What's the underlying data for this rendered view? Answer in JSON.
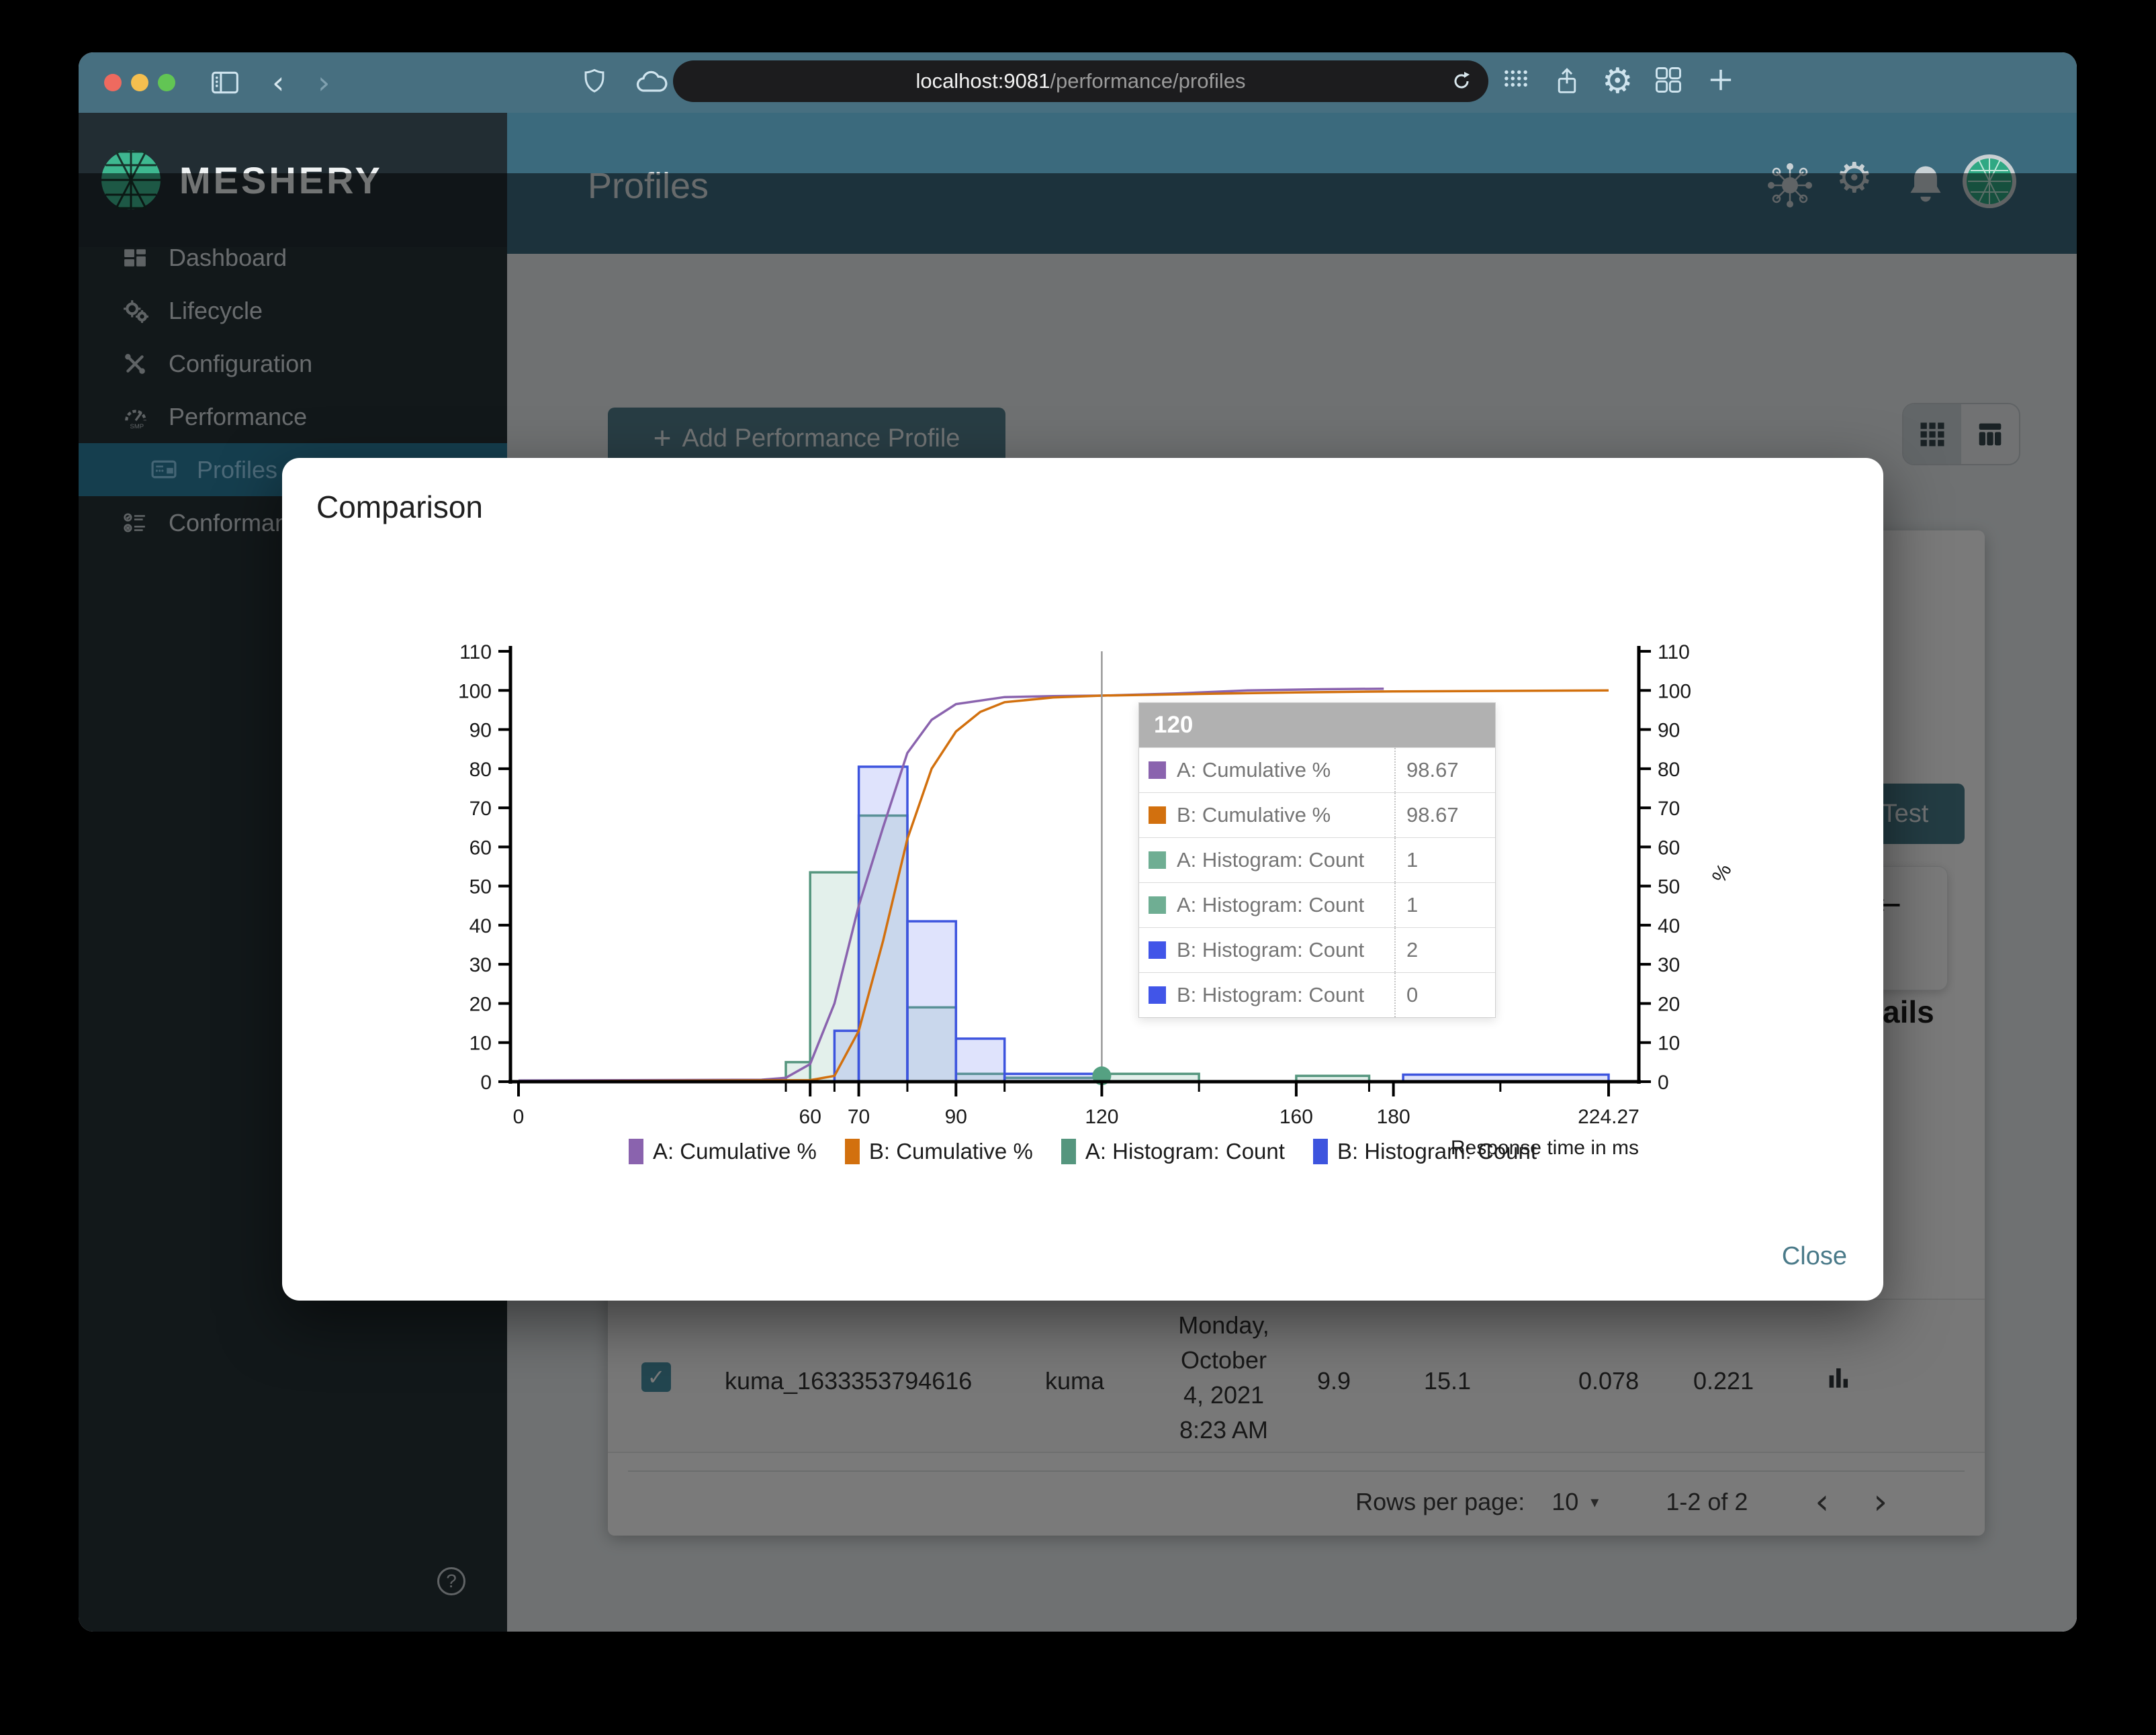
{
  "browser": {
    "url_host": "localhost:9081",
    "url_path": "/performance/profiles",
    "traffic_lights": [
      "#EE6A5F",
      "#F5BF4F",
      "#62C554"
    ]
  },
  "sidebar": {
    "brand": "MESHERY",
    "items": [
      {
        "label": "Dashboard",
        "icon": "dashboard-icon"
      },
      {
        "label": "Lifecycle",
        "icon": "lifecycle-icon"
      },
      {
        "label": "Configuration",
        "icon": "configuration-icon"
      },
      {
        "label": "Performance",
        "icon": "performance-icon"
      },
      {
        "label": "Profiles",
        "icon": "profiles-icon",
        "active": true
      },
      {
        "label": "Conformance",
        "icon": "conformance-icon"
      }
    ],
    "help_glyph": "?",
    "collapse_glyph": "«"
  },
  "header": {
    "title": "Profiles"
  },
  "content": {
    "add_button_plus": "+",
    "add_button_label": "Add Performance Profile",
    "test_button_label": "Test",
    "details_text_fragment": "ails",
    "back_arrow_glyph": "←"
  },
  "table": {
    "row": {
      "checked_glyph": "✓",
      "name": "kuma_1633353794616",
      "mesh": "kuma",
      "date_lines": [
        "Monday,",
        "October",
        "4, 2021",
        "8:23 AM"
      ],
      "values": [
        "9.9",
        "15.1",
        "0.078",
        "0.221"
      ]
    }
  },
  "pagination": {
    "label": "Rows per page:",
    "value": "10",
    "caret": "▾",
    "range": "1-2 of 2",
    "prev": "‹",
    "next": "›"
  },
  "modal": {
    "title": "Comparison",
    "close_label": "Close",
    "tooltip": {
      "header": "120",
      "rows": [
        {
          "color": "#8A63AE",
          "label": "A: Cumulative %",
          "value": "98.67"
        },
        {
          "color": "#D2700E",
          "label": "B: Cumulative %",
          "value": "98.67"
        },
        {
          "color": "#6FAE93",
          "label": "A: Histogram: Count",
          "value": "1"
        },
        {
          "color": "#6FAE93",
          "label": "A: Histogram: Count",
          "value": "1"
        },
        {
          "color": "#4155E8",
          "label": "B: Histogram: Count",
          "value": "2"
        },
        {
          "color": "#4155E8",
          "label": "B: Histogram: Count",
          "value": "0"
        }
      ]
    }
  },
  "chart_data": {
    "type": "histogram+cumulative-line",
    "x_axis": {
      "label": "Response time in ms",
      "min": 0,
      "max": 224.27,
      "labeled_ticks": [
        0,
        60,
        70,
        90,
        120,
        160,
        180,
        224.27
      ],
      "minor_ticks": [
        55,
        65,
        80,
        100,
        140,
        175,
        202
      ]
    },
    "y_axis_left": {
      "min": 0,
      "max": 110,
      "step": 10
    },
    "y_axis_right": {
      "label": "%",
      "min": 0,
      "max": 110,
      "step": 10
    },
    "crosshair_x": 120,
    "hover_marker": {
      "x": 120,
      "y": 1.5,
      "color": "#55A182"
    },
    "legend_position": "bottom",
    "series": [
      {
        "name": "A: Cumulative %",
        "type": "line",
        "color": "#8A63AE",
        "points": [
          [
            0,
            0.3
          ],
          [
            50,
            0.5
          ],
          [
            55,
            1
          ],
          [
            60,
            4.5
          ],
          [
            65,
            20
          ],
          [
            70,
            45
          ],
          [
            75,
            65
          ],
          [
            80,
            84
          ],
          [
            85,
            92.5
          ],
          [
            90,
            96.5
          ],
          [
            100,
            98.3
          ],
          [
            110,
            98.55
          ],
          [
            120,
            98.67
          ],
          [
            135,
            99.2
          ],
          [
            150,
            100
          ],
          [
            165,
            100.3
          ],
          [
            178,
            100.45
          ]
        ]
      },
      {
        "name": "B: Cumulative %",
        "type": "line",
        "color": "#D2700E",
        "points": [
          [
            0,
            0.1
          ],
          [
            60,
            0.4
          ],
          [
            65,
            1.5
          ],
          [
            70,
            13
          ],
          [
            75,
            36
          ],
          [
            80,
            62
          ],
          [
            85,
            80
          ],
          [
            90,
            89.5
          ],
          [
            95,
            94.5
          ],
          [
            100,
            97
          ],
          [
            110,
            98.2
          ],
          [
            120,
            98.67
          ],
          [
            140,
            99.1
          ],
          [
            160,
            99.5
          ],
          [
            180,
            99.75
          ],
          [
            224.27,
            100
          ]
        ]
      },
      {
        "name": "A: Histogram: Count",
        "type": "bars",
        "color": "#55967E",
        "fill": "#7FB9A2",
        "bars": [
          [
            55,
            60,
            5
          ],
          [
            60,
            70,
            53.5
          ],
          [
            70,
            80,
            68
          ],
          [
            80,
            90,
            19
          ],
          [
            90,
            100,
            2
          ],
          [
            100,
            120,
            1
          ],
          [
            120,
            140,
            2
          ],
          [
            160,
            175,
            1.5
          ]
        ]
      },
      {
        "name": "B: Histogram: Count",
        "type": "bars",
        "color": "#3D54DE",
        "fill": "#6D7EF0",
        "bars": [
          [
            65,
            70,
            13
          ],
          [
            70,
            80,
            80.5
          ],
          [
            80,
            90,
            41
          ],
          [
            90,
            100,
            11
          ],
          [
            100,
            120,
            2
          ],
          [
            182,
            224.27,
            1.8
          ]
        ]
      }
    ]
  }
}
